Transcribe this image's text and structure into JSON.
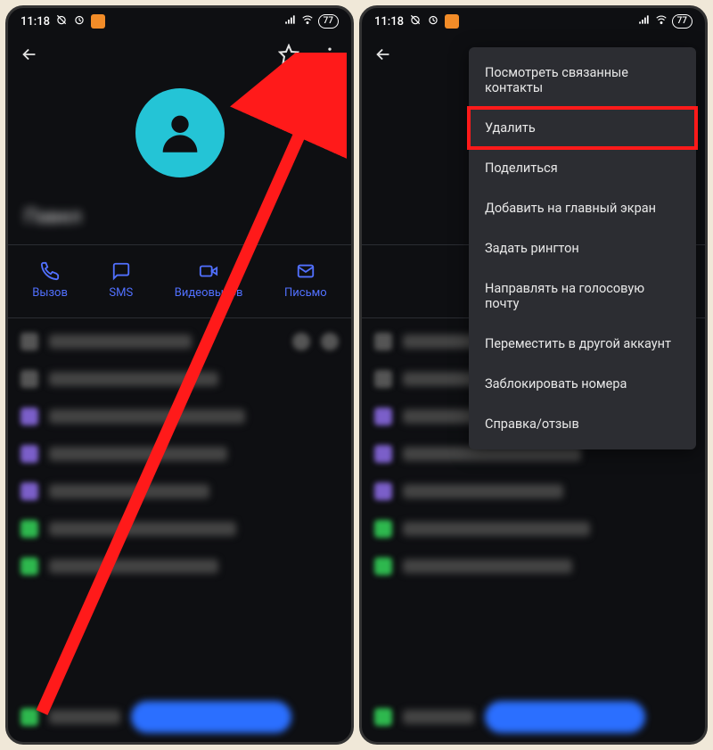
{
  "status": {
    "time": "11:18",
    "battery": "77"
  },
  "actions": {
    "call": "Вызов",
    "sms": "SMS",
    "video": "Видеовызов",
    "email": "Письмо"
  },
  "menu": {
    "items": [
      "Посмотреть связанные контакты",
      "Удалить",
      "Поделиться",
      "Добавить на главный экран",
      "Задать рингтон",
      "Направлять на голосовую почту",
      "Переместить в другой аккаунт",
      "Заблокировать номера",
      "Справка/отзыв"
    ]
  },
  "contact_name_placeholder": "Павел"
}
